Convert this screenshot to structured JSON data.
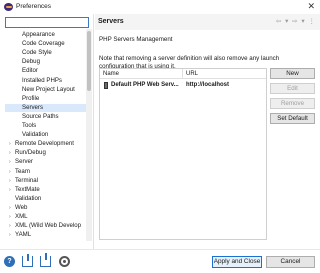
{
  "window": {
    "title": "Preferences",
    "close_glyph": "✕"
  },
  "filter": {
    "placeholder": "",
    "value": ""
  },
  "tree": {
    "items": [
      {
        "label": "Appearance",
        "level": "child",
        "arrow": ""
      },
      {
        "label": "Code Coverage",
        "level": "child",
        "arrow": ""
      },
      {
        "label": "Code Style",
        "level": "child",
        "arrow": ""
      },
      {
        "label": "Debug",
        "level": "child",
        "arrow": ""
      },
      {
        "label": "Editor",
        "level": "child",
        "arrow": ""
      },
      {
        "label": "Installed PHPs",
        "level": "child",
        "arrow": ""
      },
      {
        "label": "New Project Layout",
        "level": "child",
        "arrow": ""
      },
      {
        "label": "Profile",
        "level": "child",
        "arrow": ""
      },
      {
        "label": "Servers",
        "level": "child",
        "arrow": "",
        "selected": true
      },
      {
        "label": "Source Paths",
        "level": "child",
        "arrow": ""
      },
      {
        "label": "Tools",
        "level": "child",
        "arrow": ""
      },
      {
        "label": "Validation",
        "level": "child",
        "arrow": ""
      },
      {
        "label": "Remote Development",
        "level": "top",
        "arrow": "›"
      },
      {
        "label": "Run/Debug",
        "level": "top",
        "arrow": "›"
      },
      {
        "label": "Server",
        "level": "top",
        "arrow": "›"
      },
      {
        "label": "Team",
        "level": "top",
        "arrow": "›"
      },
      {
        "label": "Terminal",
        "level": "top",
        "arrow": "›"
      },
      {
        "label": "TextMate",
        "level": "top",
        "arrow": "›"
      },
      {
        "label": "Validation",
        "level": "top",
        "arrow": ""
      },
      {
        "label": "Web",
        "level": "top",
        "arrow": "›"
      },
      {
        "label": "XML",
        "level": "top",
        "arrow": "›"
      },
      {
        "label": "XML (Wild Web Develop",
        "level": "top",
        "arrow": "›"
      },
      {
        "label": "YAML",
        "level": "top",
        "arrow": "›"
      }
    ]
  },
  "pane": {
    "title": "Servers",
    "nav_glyphs": "⇦ ▾ ⇨ ▾ ⋮",
    "section_title": "PHP Servers Management",
    "note": "Note that removing a server definition will also remove any launch configuration that is using it."
  },
  "table": {
    "columns": [
      "Name",
      "URL"
    ],
    "rows": [
      {
        "name": "Default PHP Web Serv...",
        "url": "http://localhost",
        "icon": "server-icon"
      }
    ]
  },
  "side_buttons": {
    "new": "New",
    "edit": "Edit",
    "remove": "Remove",
    "set_default": "Set Default"
  },
  "footer": {
    "help_glyph": "?",
    "apply_close": "Apply and Close",
    "cancel": "Cancel"
  },
  "colors": {
    "selection": "#d9e8fb",
    "focus_border": "#1d6fd1",
    "header_bg": "#f4f4f4"
  }
}
